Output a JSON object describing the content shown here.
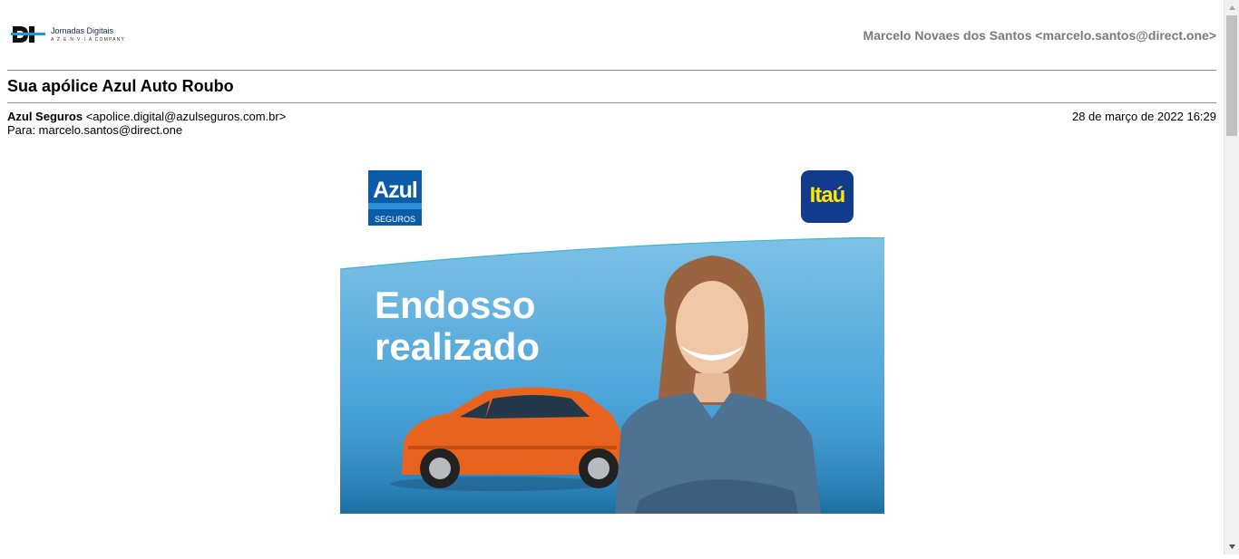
{
  "header": {
    "brand_name": "Jornadas Digitais",
    "brand_sub": "A Z·E·N·V·I·A COMPANY",
    "account": "Marcelo Novaes dos Santos <marcelo.santos@direct.one>"
  },
  "email": {
    "subject": "Sua apólice Azul Auto Roubo",
    "sender_name": "Azul Seguros",
    "sender_address": "<apolice.digital@azulseguros.com.br>",
    "to_line": "Para: marcelo.santos@direct.one",
    "date": "28 de março de 2022 16:29"
  },
  "content": {
    "azul_logo_word": "Azul",
    "azul_logo_sub": "SEGUROS",
    "itau_logo_word": "Itaú",
    "banner_line1": "Endosso",
    "banner_line2": "realizado"
  },
  "colors": {
    "azul_blue": "#0a5ca8",
    "itau_blue": "#123b8d",
    "itau_yellow": "#ffe600",
    "banner_sky": "#5aa9d9",
    "car_orange": "#e8641e"
  },
  "icons": {
    "scroll_up": "triangle-up-icon",
    "scroll_down": "triangle-down-icon"
  }
}
